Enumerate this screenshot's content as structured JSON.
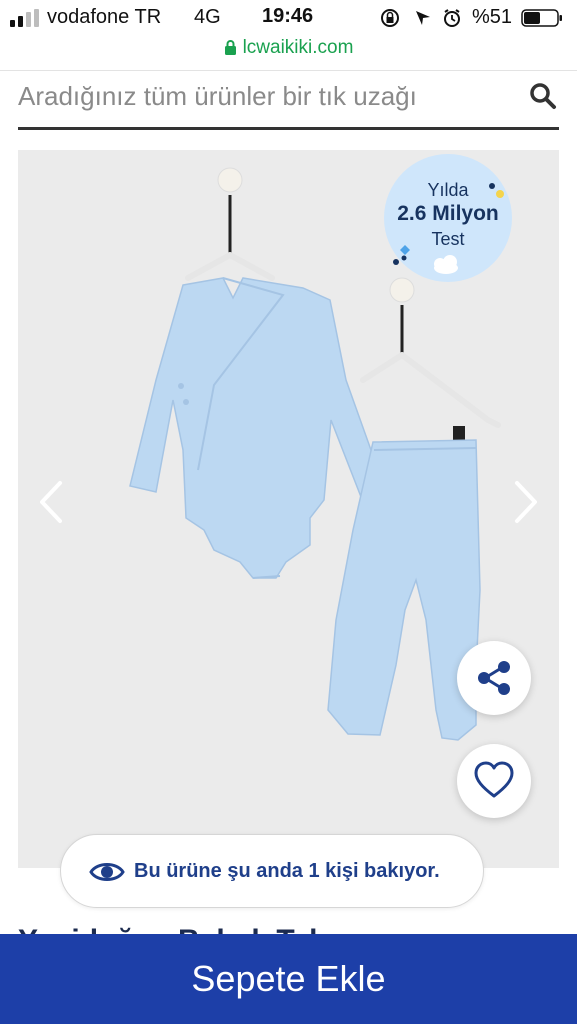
{
  "status_bar": {
    "carrier": "vodafone TR",
    "network": "4G",
    "time": "19:46",
    "battery_percent": "%51",
    "battery_level": 0.51,
    "icons": [
      "signal-icon",
      "orientation-lock-icon",
      "location-icon",
      "alarm-icon",
      "battery-icon"
    ]
  },
  "browser": {
    "url": "lcwaikiki.com",
    "secure": true,
    "accent": "#1aa14f"
  },
  "search": {
    "placeholder": "Aradığınız tüm ürünler bir tık uzağı",
    "value": "",
    "icon": "search-icon"
  },
  "gallery": {
    "badge": {
      "line1": "Yılda",
      "line2": "2.6 Milyon",
      "line3": "Test"
    },
    "icons": [
      "chevron-left-icon",
      "chevron-right-icon",
      "share-icon",
      "heart-icon"
    ],
    "garment_color": "#bcd8f2",
    "background": "#ebebeb"
  },
  "viewers": {
    "icon": "eye-icon",
    "text": "Bu ürüne şu anda 1 kişi bakıyor."
  },
  "product": {
    "title_partial": "Yenidoğan Bebek Takım"
  },
  "cart": {
    "label": "Sepete Ekle",
    "color": "#1d3fa8"
  }
}
